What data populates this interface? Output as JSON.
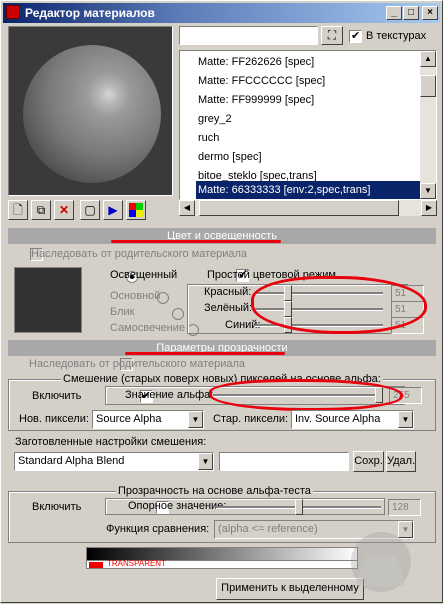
{
  "window": {
    "title": "Редактор материалов",
    "min": "_",
    "max": "□",
    "close": "×"
  },
  "search": {
    "value": "",
    "in_textures_label": "В текстурах",
    "in_textures_checked": true
  },
  "materials": {
    "items": [
      "Matte: FF262626 [spec]",
      "Matte: FFCCCCCC [spec]",
      "Matte: FF999999 [spec]",
      "grey_2",
      "ruch",
      "dermo [spec]",
      "bitoe_steklo [spec,trans]",
      "Matte: 66333333 [env:2,spec,trans]"
    ],
    "selected_index": 7
  },
  "color_section": {
    "header": "Цвет и освещенность",
    "inherit_label": "Наследовать от родительского материала",
    "lit_label": "Освещенный",
    "simple_color_label": "Простой цветовой режим",
    "base_label": "Основной",
    "glare_label": "Блик",
    "self_label": "Самосвечение",
    "red_label": "Красный:",
    "green_label": "Зелёный:",
    "blue_label": "Синий:",
    "red_value": "51",
    "green_value": "51",
    "blue_value": "51",
    "swatch_color": "#333333"
  },
  "transparency_section": {
    "header": "Параметры прозрачности",
    "inherit_label": "Наследовать от родительского материала",
    "blend_group_label": "Смешение (старых поверх новых) пикселей на основе альфа:",
    "enable_label": "Включить",
    "alpha_value_label": "Значение альфа:",
    "alpha_value": "255",
    "new_pixels_label": "Нов. пиксели:",
    "new_pixels_value": "Source Alpha",
    "old_pixels_label": "Стар. пиксели:",
    "old_pixels_value": "Inv. Source Alpha",
    "presets_label": "Заготовленные настройки смешения:",
    "preset_value": "Standard Alpha Blend",
    "preset_name_value": "",
    "save_label": "Сохр.",
    "delete_label": "Удал.",
    "alpha_test_label": "Прозрачность на основе альфа-теста",
    "alpha_test_enable_label": "Включить",
    "ref_value_label": "Опорное значение:",
    "ref_value": "128",
    "compare_label": "Функция сравнения:",
    "compare_value": "(alpha <= reference)",
    "transparent_label": "TRANSPARENT"
  },
  "footer": {
    "apply_label": "Применить к выделенному"
  },
  "colors": {
    "annotation_red": "#e8000c",
    "selection": "#0a246a",
    "header_gray": "#a8a8a8"
  }
}
